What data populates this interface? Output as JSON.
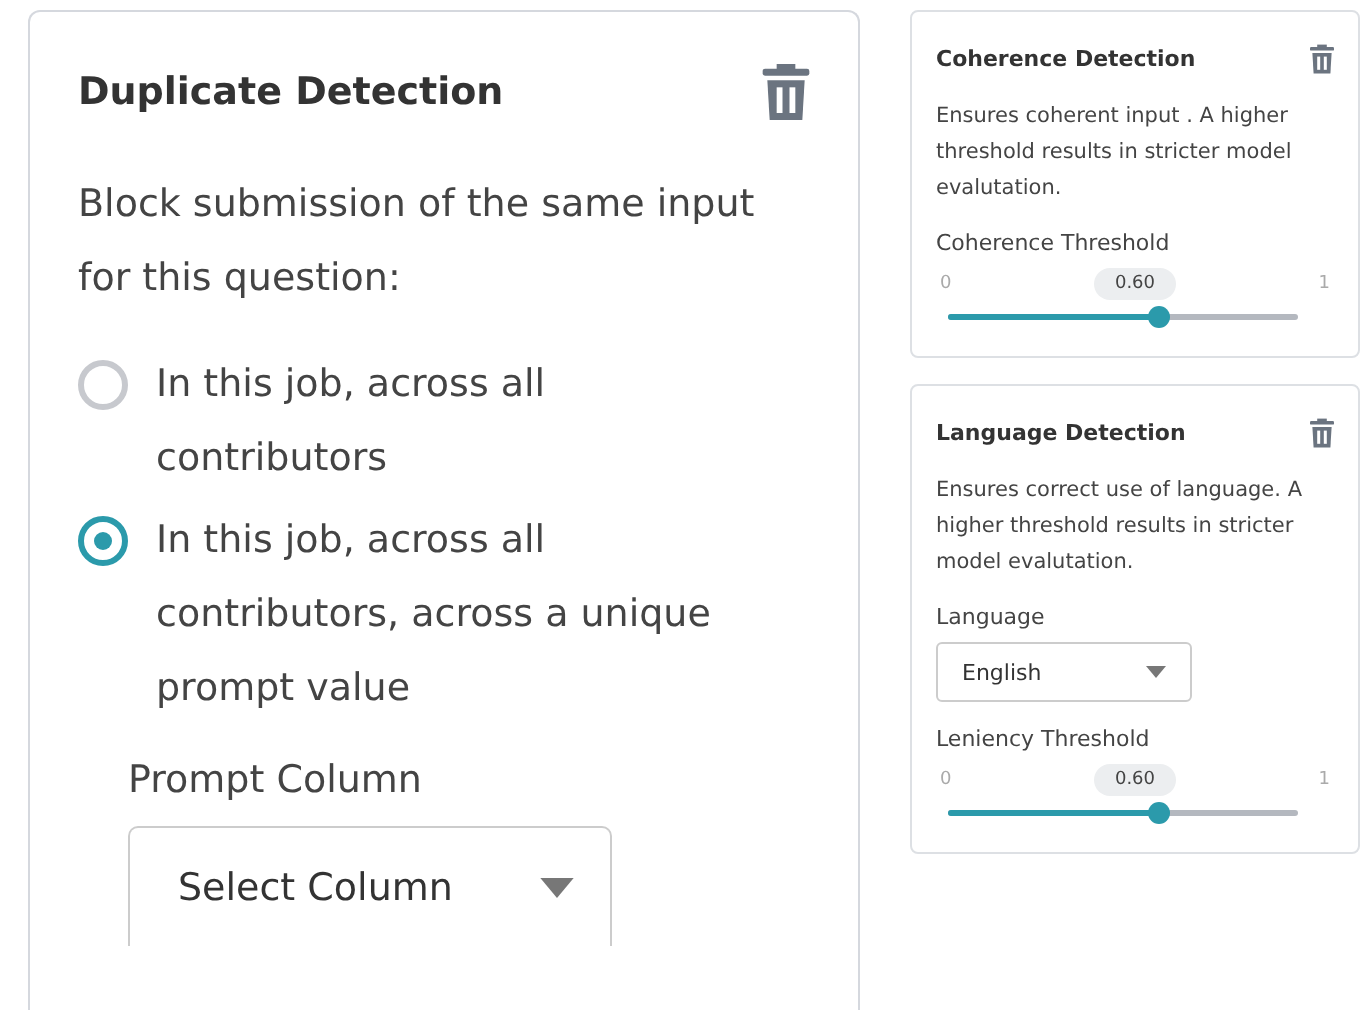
{
  "duplicate": {
    "title": "Duplicate Detection",
    "description": "Block submission of the same input for this question:",
    "options": [
      {
        "label": "In this job, across all contributors",
        "selected": false
      },
      {
        "label": "In this job, across all contributors, across a unique prompt value",
        "selected": true
      }
    ],
    "prompt_column": {
      "label": "Prompt Column",
      "value": "Select Column"
    }
  },
  "panels": [
    {
      "title": "Coherence Detection",
      "description": "Ensures coherent input . A higher threshold results in stricter model evalutation.",
      "fields": [
        {
          "kind": "slider",
          "label": "Coherence Threshold",
          "min": "0",
          "max": "1",
          "reading": "0.60",
          "level": 0.6
        }
      ]
    },
    {
      "title": "Language Detection",
      "description": "Ensures correct use of language. A higher threshold results in stricter model evalutation.",
      "fields": [
        {
          "kind": "select",
          "label": "Language",
          "value": "English"
        },
        {
          "kind": "slider",
          "label": "Leniency Threshold",
          "min": "0",
          "max": "1",
          "reading": "0.60",
          "level": 0.6
        }
      ]
    }
  ]
}
